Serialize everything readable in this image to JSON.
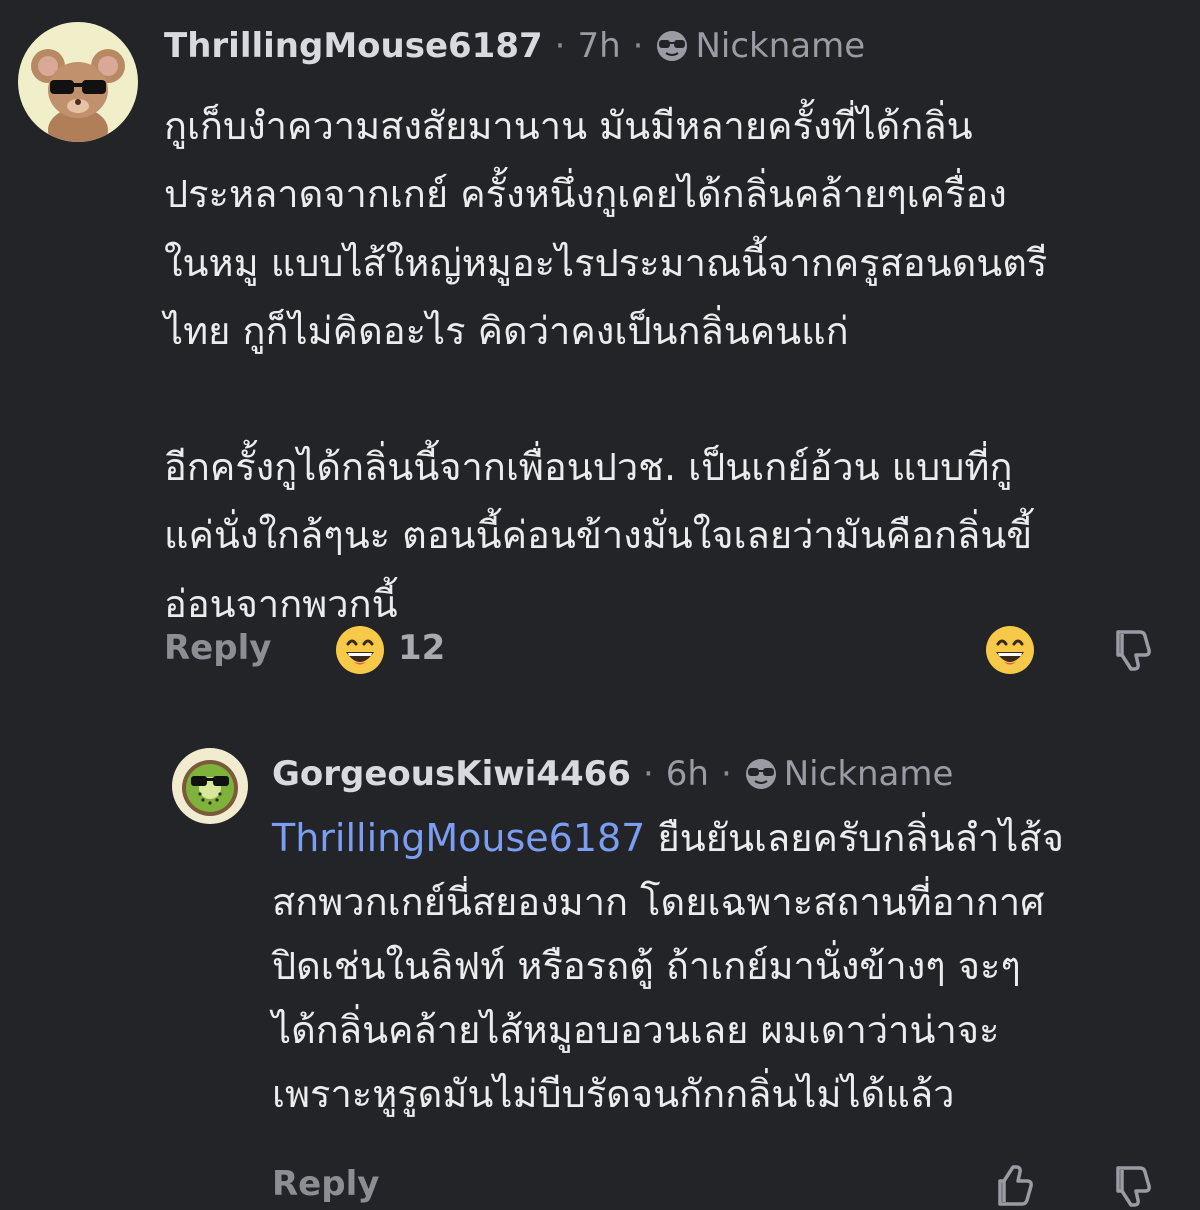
{
  "comments": [
    {
      "username": "ThrillingMouse6187",
      "time": "7h",
      "flair": "Nickname",
      "paragraphs": [
        [
          "กูเก็บงำความสงสัยมานาน มันมีหลายครั้งที่ได้กลิ่น",
          "ประหลาดจากเกย์ ครั้งหนึ่งกูเคยได้กลิ่นคล้ายๆเครื่อง",
          "ในหมู แบบไส้ใหญ่หมูอะไรประมาณนี้จากครูสอนดนตรี",
          "ไทย กูก็ไม่คิดอะไร คิดว่าคงเป็นกลิ่นคนแก่"
        ],
        [
          "อีกครั้งกูได้กลิ่นนี้จากเพื่อนปวช. เป็นเกย์อ้วน แบบที่กู",
          "แค่นั่งใกล้ๆนะ ตอนนี้ค่อนข้างมั่นใจเลยว่ามันคือกลิ่นขี้",
          "อ่อนจากพวกนี้"
        ]
      ],
      "reply_label": "Reply",
      "reaction_count": "12",
      "avatar": "mouse-with-sunglasses"
    },
    {
      "username": "GorgeousKiwi4466",
      "time": "6h",
      "flair": "Nickname",
      "mention": "ThrillingMouse6187",
      "first_line_rest": " ยืนยันเลยครับกลิ่นลำไส้จ",
      "lines": [
        "สกพวกเกย์นี่สยองมาก โดยเฉพาะสถานที่อากาศ",
        "ปิดเช่นในลิฟท์ หรือรถตู้ ถ้าเกย์มานั่งข้างๆ จะๆ",
        "ได้กลิ่นคล้ายไส้หมูอบอวนเลย ผมเดาว่าน่าจะ",
        "เพราะหูรูดมันไม่บีบรัดจนกักกลิ่นไม่ได้แล้ว"
      ],
      "reply_label": "Reply",
      "avatar": "kiwi-with-sunglasses"
    }
  ],
  "colors": {
    "background": "#232428",
    "text": "#ececee",
    "muted": "#9a9ca3",
    "mention": "#7b9df2",
    "emoji": "#f7c948"
  },
  "icons": [
    "sunglasses-emoji-icon",
    "grinning-emoji-icon",
    "thumbs-down-icon",
    "thumbs-up-icon"
  ]
}
